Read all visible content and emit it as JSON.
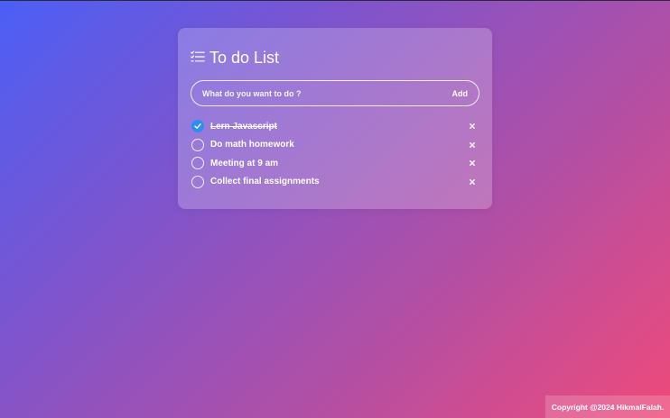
{
  "app": {
    "title": "To do List",
    "title_icon": "list-check-icon"
  },
  "input": {
    "value": "",
    "placeholder": "What do you want to do ?",
    "add_label": "Add"
  },
  "todos": [
    {
      "text": "Lern Javascript",
      "done": true
    },
    {
      "text": "Do math homework",
      "done": false
    },
    {
      "text": "Meeting at 9 am",
      "done": false
    },
    {
      "text": "Collect final assignments",
      "done": false
    }
  ],
  "remove_icon": "close-icon",
  "footer": {
    "copyright": "Copyright @2024 HikmalFalah."
  },
  "colors": {
    "gradient_start": "#4b5ff6",
    "gradient_end": "#ef4a7a",
    "check_done": "#2b8ef0"
  }
}
